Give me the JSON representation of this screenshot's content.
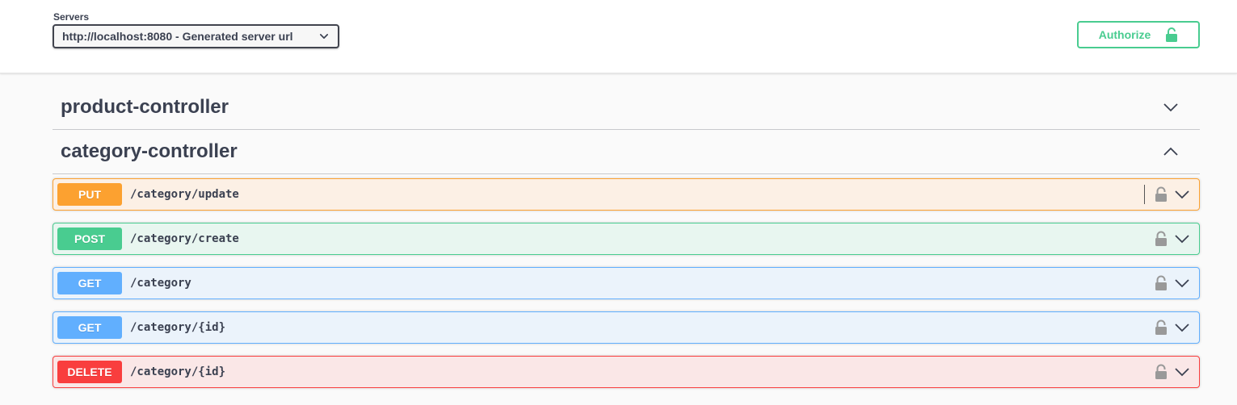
{
  "servers": {
    "label": "Servers",
    "selected": "http://localhost:8080 - Generated server url"
  },
  "authorize": {
    "label": "Authorize"
  },
  "tags": [
    {
      "name": "product-controller",
      "expanded": false
    },
    {
      "name": "category-controller",
      "expanded": true
    }
  ],
  "operations": [
    {
      "method": "PUT",
      "path": "/category/update",
      "color": "#fca130"
    },
    {
      "method": "POST",
      "path": "/category/create",
      "color": "#49cc90"
    },
    {
      "method": "GET",
      "path": "/category",
      "color": "#61affe"
    },
    {
      "method": "GET",
      "path": "/category/{id}",
      "color": "#61affe"
    },
    {
      "method": "DELETE",
      "path": "/category/{id}",
      "color": "#f93e3e"
    }
  ],
  "icons": {
    "select": "chevron-down-icon",
    "authorize": "lock-open-icon",
    "tag_collapsed": "chevron-down-icon",
    "tag_expanded": "chevron-up-icon",
    "op_lock": "lock-icon",
    "op_expand": "chevron-down-icon"
  }
}
